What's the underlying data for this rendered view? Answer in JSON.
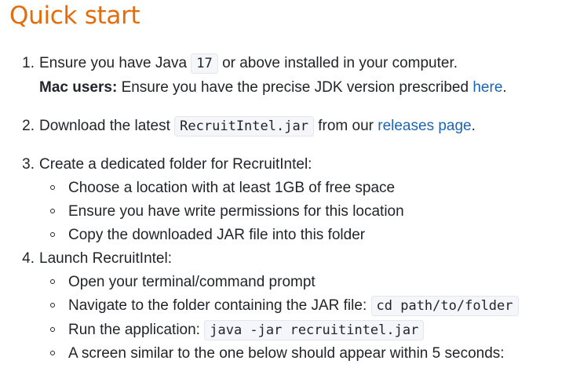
{
  "title": "Quick start",
  "steps": [
    {
      "number": "1.",
      "pre": "Ensure you have Java",
      "code": "17",
      "post": "or above installed in your computer.",
      "note": {
        "bold": "Mac users:",
        "text": "Ensure you have the precise JDK version prescribed",
        "link": "here",
        "end": "."
      }
    },
    {
      "number": "2.",
      "pre": "Download the latest",
      "code": "RecruitIntel.jar",
      "post": "from our",
      "link": "releases page",
      "end": "."
    },
    {
      "number": "3.",
      "text": "Create a dedicated folder for RecruitIntel:",
      "bullets": [
        "Choose a location with at least 1GB of free space",
        "Ensure you have write permissions for this location",
        "Copy the downloaded JAR file into this folder"
      ]
    },
    {
      "number": "4.",
      "text": "Launch RecruitIntel:",
      "bullets": [
        {
          "text": "Open your terminal/command prompt"
        },
        {
          "text": "Navigate to the folder containing the JAR file:",
          "code": "cd path/to/folder"
        },
        {
          "text": "Run the application:",
          "code": "java -jar recruitintel.jar"
        },
        {
          "text": "A screen similar to the one below should appear within 5 seconds:"
        }
      ]
    }
  ]
}
